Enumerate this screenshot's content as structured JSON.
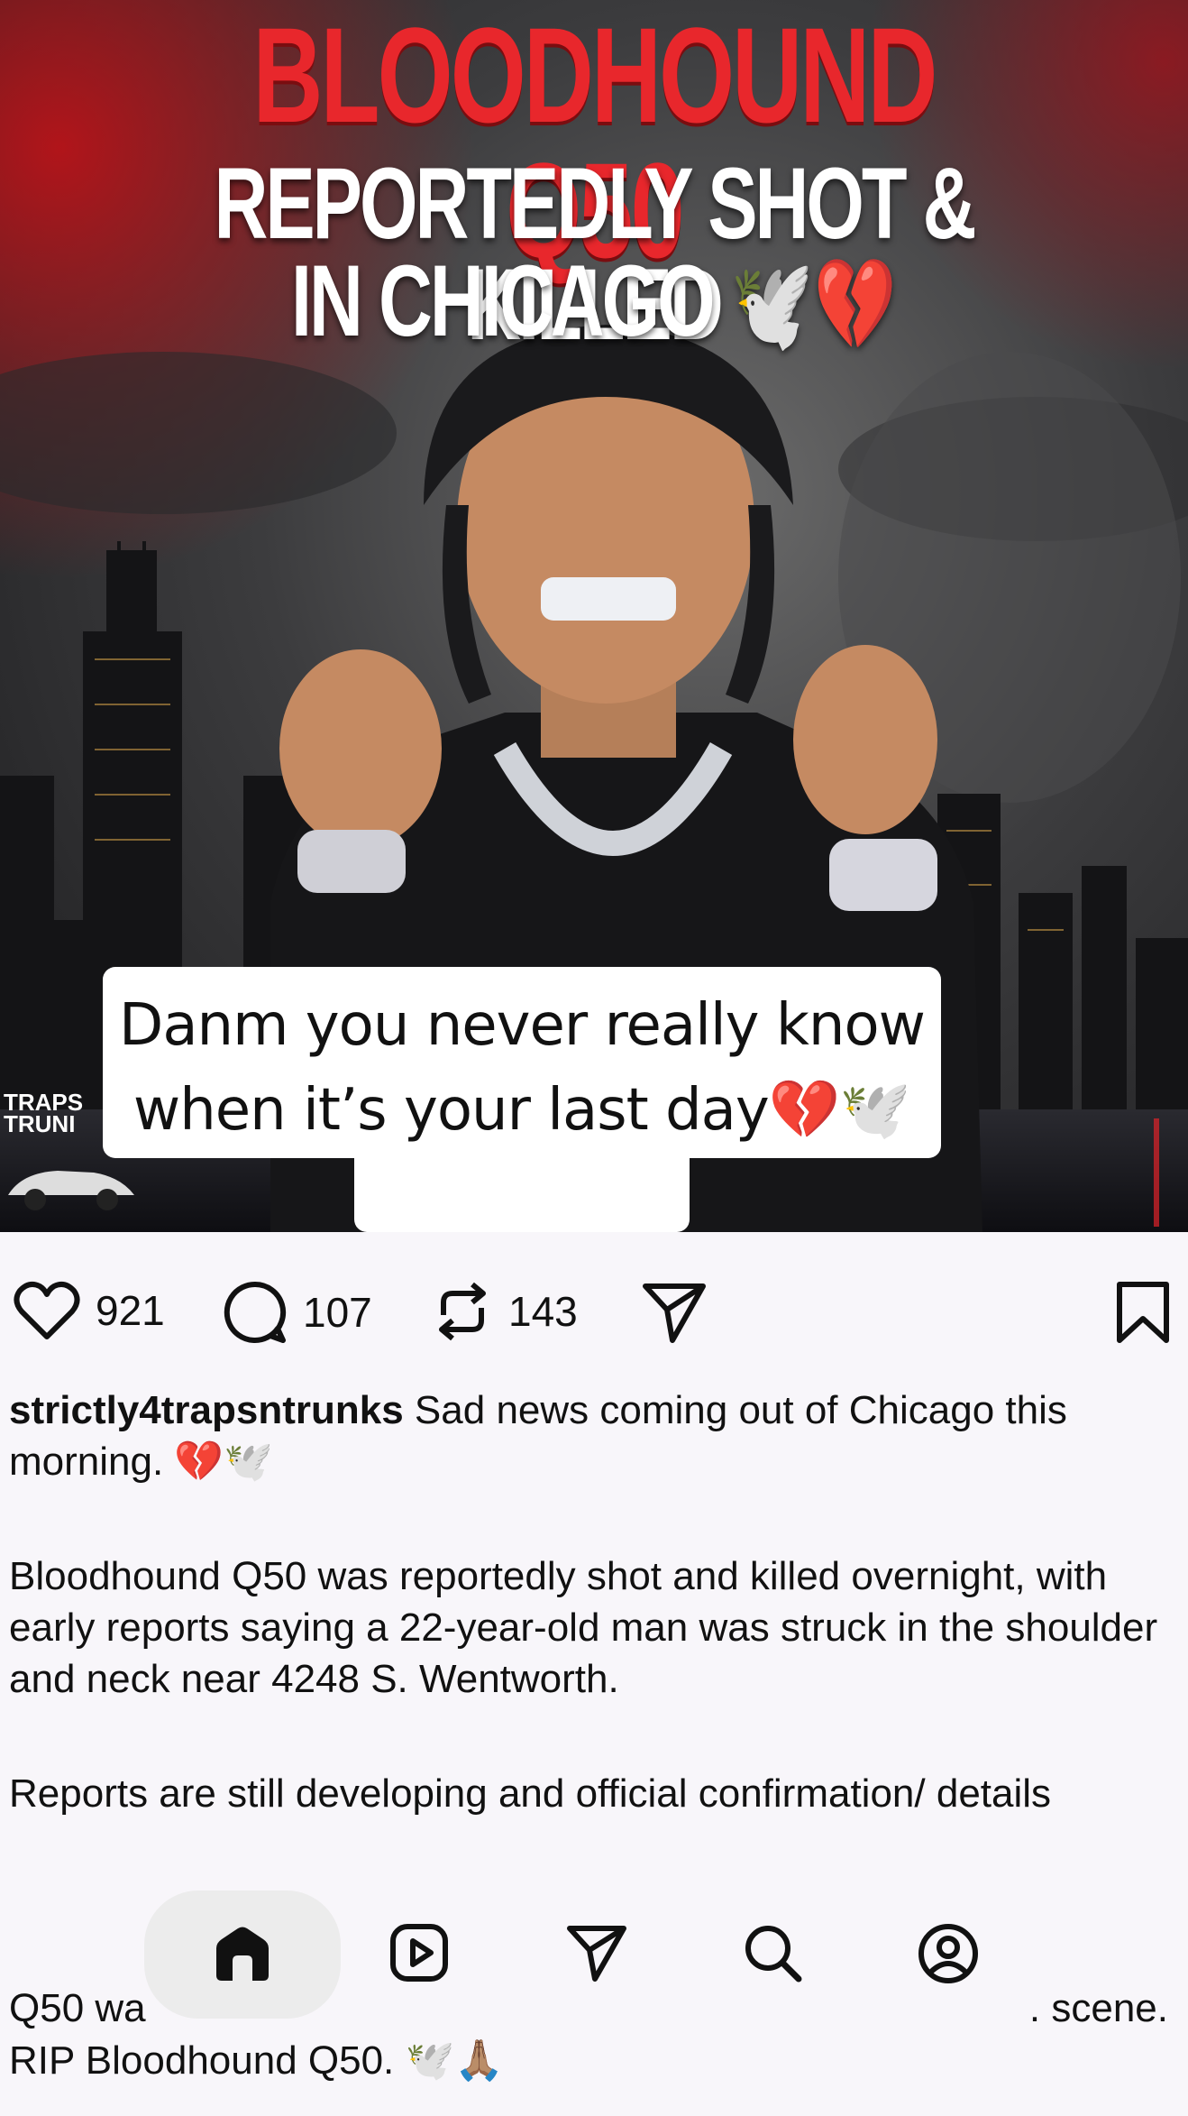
{
  "hero": {
    "headline_line1": "BLOODHOUND Q50",
    "headline_line2": "REPORTEDLY SHOT & KILLED",
    "headline_line3": "IN CHICAGO",
    "headline_emoji": "🕊️💔",
    "overlay_caption": "Danm you never really know when it’s your last day💔🕊️",
    "watermark_line1": "TRAPS",
    "watermark_line2": "TRUNI"
  },
  "actions": {
    "likes": "921",
    "comments": "107",
    "reposts": "143"
  },
  "post": {
    "username": "strictly4trapsntrunks",
    "para1": " Sad news coming out of Chicago this morning. 💔🕊️",
    "para2": "Bloodhound Q50 was reportedly shot and killed overnight, with early reports saying a 22-year-old man was struck in the shoulder and neck near 4248 S. Wentworth.",
    "para3": "Reports are still developing and official confirmation/ details",
    "line4_left": "Q50 wa",
    "line4_right": ". scene.",
    "line5": "RIP Bloodhound Q50. 🕊️🙏🏽"
  },
  "nav": {
    "items": [
      "home-icon",
      "reels-icon",
      "send-icon",
      "search-icon",
      "profile-icon"
    ]
  },
  "colors": {
    "headline_red": "#e8272c",
    "background": "#f8f6fa"
  }
}
